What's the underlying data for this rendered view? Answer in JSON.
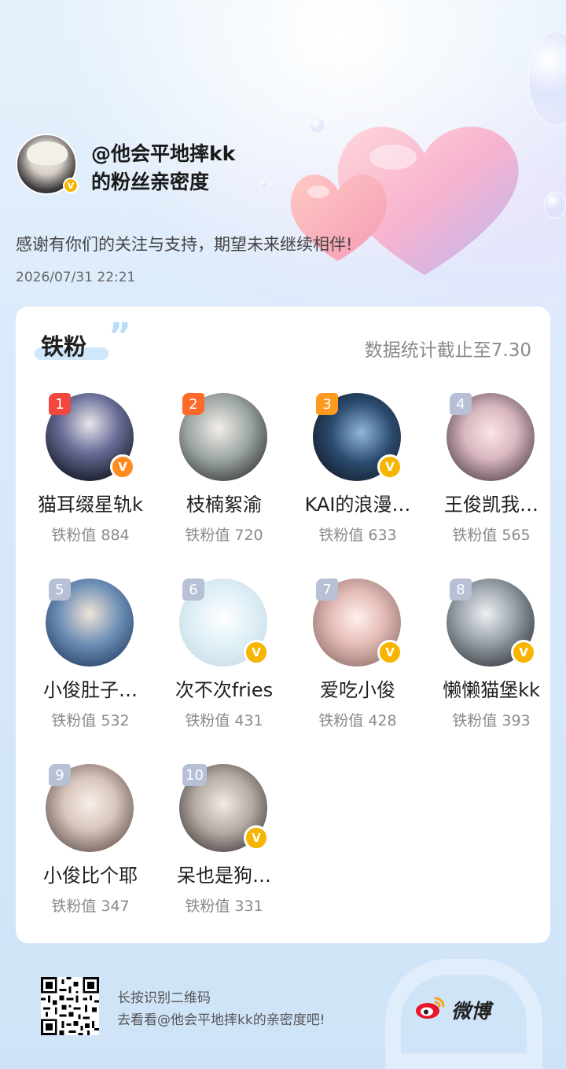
{
  "header": {
    "name_line1": "@他会平地摔kk",
    "name_line2": "的粉丝亲密度",
    "verified_glyph": "V",
    "thanks": "感谢有你们的关注与支持，期望未来继续相伴!",
    "datetime": "2026/07/31  22:21"
  },
  "card": {
    "title": "铁粉",
    "title_quote": "”",
    "note": "数据统计截止至7.30",
    "fans": [
      {
        "rank": "1",
        "nick": "猫耳缀星轨k",
        "score": "铁粉值 884",
        "rank_color": "#f2473e",
        "badge": "orange",
        "badge_glyph": "V"
      },
      {
        "rank": "2",
        "nick": "枝楠絮渝",
        "score": "铁粉值 720",
        "rank_color": "#ff6a2b",
        "badge": "",
        "badge_glyph": ""
      },
      {
        "rank": "3",
        "nick": "KAI的浪漫…",
        "score": "铁粉值 633",
        "rank_color": "#ff9a1f",
        "badge": "yellow",
        "badge_glyph": "V"
      },
      {
        "rank": "4",
        "nick": "王俊凯我…",
        "score": "铁粉值 565",
        "rank_color": "#b8c0d6",
        "badge": "",
        "badge_glyph": ""
      },
      {
        "rank": "5",
        "nick": "小俊肚子…",
        "score": "铁粉值 532",
        "rank_color": "#b8c0d6",
        "badge": "",
        "badge_glyph": ""
      },
      {
        "rank": "6",
        "nick": "次不次fries",
        "score": "铁粉值 431",
        "rank_color": "#b8c0d6",
        "badge": "yellow",
        "badge_glyph": "V"
      },
      {
        "rank": "7",
        "nick": "爱吃小俊",
        "score": "铁粉值 428",
        "rank_color": "#b8c0d6",
        "badge": "yellow",
        "badge_glyph": "V"
      },
      {
        "rank": "8",
        "nick": "懒懒猫堡kk",
        "score": "铁粉值 393",
        "rank_color": "#b8c0d6",
        "badge": "yellow",
        "badge_glyph": "V"
      },
      {
        "rank": "9",
        "nick": "小俊比个耶",
        "score": "铁粉值 347",
        "rank_color": "#b8c0d6",
        "badge": "",
        "badge_glyph": ""
      },
      {
        "rank": "10",
        "nick": "呆也是狗…",
        "score": "铁粉值 331",
        "rank_color": "#b8c0d6",
        "badge": "yellow",
        "badge_glyph": "V"
      }
    ]
  },
  "footer": {
    "line1": "长按识别二维码",
    "line2": "去看看@他会平地摔kk的亲密度吧!",
    "brand": "微博"
  },
  "colors": {
    "rank_top1": "#f2473e",
    "rank_top2": "#ff6a2b",
    "rank_top3": "#ff9a1f",
    "rank_other": "#b8c0d6",
    "badge_orange": "#ff8b1f",
    "badge_yellow": "#f7b500"
  },
  "icons": {
    "verified": "verified-badge-icon",
    "qr": "qr-code-icon",
    "brand": "weibo-logo-icon",
    "decor": [
      "heart-decoration",
      "bubble-decoration",
      "cloud-decoration"
    ]
  }
}
